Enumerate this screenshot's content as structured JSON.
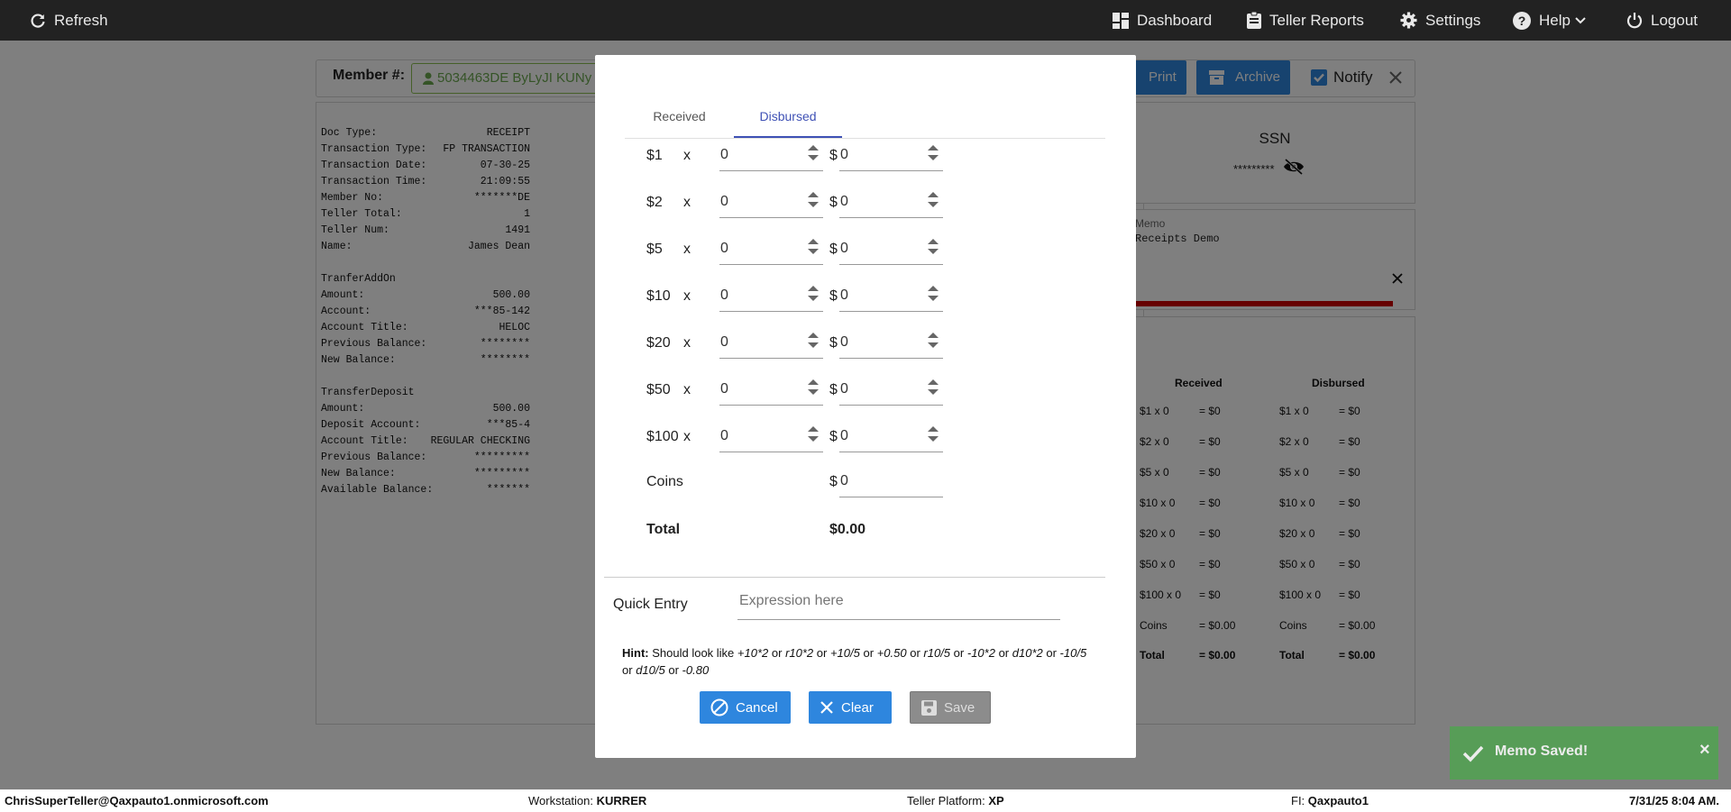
{
  "topbar": {
    "refresh": "Refresh",
    "dashboard": "Dashboard",
    "teller_reports": "Teller Reports",
    "settings": "Settings",
    "help": "Help",
    "logout": "Logout"
  },
  "member": {
    "label": "Member #:",
    "value": "5034463DE ByLyJI KUNy"
  },
  "toolbar": {
    "print": "Print",
    "archive": "Archive",
    "notify": "Notify"
  },
  "receipt": {
    "rows": [
      {
        "k": "Doc Type:",
        "v": "RECEIPT"
      },
      {
        "k": "Transaction Type:",
        "v": "FP TRANSACTION"
      },
      {
        "k": "Transaction Date:",
        "v": "07-30-25"
      },
      {
        "k": "Transaction Time:",
        "v": "21:09:55"
      },
      {
        "k": "Member No:",
        "v": "*******DE"
      },
      {
        "k": "Teller Total:",
        "v": "1"
      },
      {
        "k": "Teller Num:",
        "v": "1491"
      },
      {
        "k": "Name:",
        "v": "James Dean"
      },
      {
        "k": "",
        "v": ""
      },
      {
        "k": "TranferAddOn",
        "v": ""
      },
      {
        "k": "Amount:",
        "v": "500.00"
      },
      {
        "k": "Account:",
        "v": "***85-142"
      },
      {
        "k": "Account Title:",
        "v": "HELOC"
      },
      {
        "k": "Previous Balance:",
        "v": "********"
      },
      {
        "k": "New Balance:",
        "v": "********"
      },
      {
        "k": "",
        "v": ""
      },
      {
        "k": "TransferDeposit",
        "v": ""
      },
      {
        "k": "Amount:",
        "v": "500.00"
      },
      {
        "k": "Deposit Account:",
        "v": "***85-4"
      },
      {
        "k": "Account Title:",
        "v": "REGULAR CHECKING"
      },
      {
        "k": "Previous Balance:",
        "v": "*********"
      },
      {
        "k": "New Balance:",
        "v": "*********"
      },
      {
        "k": "Available Balance:",
        "v": "*******"
      }
    ]
  },
  "ssn": {
    "label": "SSN",
    "value": "*********"
  },
  "memo": {
    "label": "Memo",
    "text": "Receipts Demo"
  },
  "summary": {
    "received_header": "Received",
    "disbursed_header": "Disbursed",
    "received": [
      {
        "label": "$1 x 0",
        "eq": "= $0"
      },
      {
        "label": "$2 x 0",
        "eq": "= $0"
      },
      {
        "label": "$5 x 0",
        "eq": "= $0"
      },
      {
        "label": "$10 x 0",
        "eq": "= $0"
      },
      {
        "label": "$20 x 0",
        "eq": "= $0"
      },
      {
        "label": "$50 x 0",
        "eq": "= $0"
      },
      {
        "label": "$100 x 0",
        "eq": "= $0"
      },
      {
        "label": "Coins",
        "eq": "= $0.00"
      },
      {
        "label": "Total",
        "eq": "= $0.00"
      }
    ],
    "disbursed": [
      {
        "label": "$1 x 0",
        "eq": "= $0"
      },
      {
        "label": "$2 x 0",
        "eq": "= $0"
      },
      {
        "label": "$5 x 0",
        "eq": "= $0"
      },
      {
        "label": "$10 x 0",
        "eq": "= $0"
      },
      {
        "label": "$20 x 0",
        "eq": "= $0"
      },
      {
        "label": "$50 x 0",
        "eq": "= $0"
      },
      {
        "label": "$100 x 0",
        "eq": "= $0"
      },
      {
        "label": "Coins",
        "eq": "= $0.00"
      },
      {
        "label": "Total",
        "eq": "= $0.00"
      }
    ]
  },
  "modal": {
    "tabs": [
      "Received",
      "Disbursed"
    ],
    "active_tab": "Disbursed",
    "denominations": [
      {
        "label": "$1",
        "times": "x",
        "count": "0",
        "amount": "0"
      },
      {
        "label": "$2",
        "times": "x",
        "count": "0",
        "amount": "0"
      },
      {
        "label": "$5",
        "times": "x",
        "count": "0",
        "amount": "0"
      },
      {
        "label": "$10",
        "times": "x",
        "count": "0",
        "amount": "0"
      },
      {
        "label": "$20",
        "times": "x",
        "count": "0",
        "amount": "0"
      },
      {
        "label": "$50",
        "times": "x",
        "count": "0",
        "amount": "0"
      },
      {
        "label": "$100",
        "times": "x",
        "count": "0",
        "amount": "0"
      }
    ],
    "dollar_sign": "$",
    "coins_label": "Coins",
    "coins_value": "0",
    "total_label": "Total",
    "total_value": "$0.00",
    "quick_entry_label": "Quick Entry",
    "quick_entry_placeholder": "Expression here",
    "hint": {
      "label": "Hint:",
      "lead": "Should look like",
      "examples": [
        "+10*2",
        "r10*2",
        "+10/5",
        "+0.50",
        "r10/5",
        "-10*2",
        "d10*2",
        "-10/5",
        "d10/5",
        "-0.80"
      ],
      "sep": "or"
    },
    "buttons": {
      "cancel": "Cancel",
      "clear": "Clear",
      "save": "Save"
    }
  },
  "toast": {
    "message": "Memo Saved!",
    "close": "×"
  },
  "status": {
    "user": "ChrisSuperTeller@Qaxpauto1.onmicrosoft.com",
    "workstation_label": "Workstation:",
    "workstation": "KURRER",
    "platform_label": "Teller Platform:",
    "platform": "XP",
    "fi_label": "FI:",
    "fi": "Qaxpauto1",
    "datetime": "7/31/25 8:04 AM."
  },
  "colors": {
    "primary": "#2e86de",
    "tab_active": "#3f51b5",
    "toast": "#51a351",
    "topbar": "#222222",
    "memo_progress": "#cc0000"
  }
}
